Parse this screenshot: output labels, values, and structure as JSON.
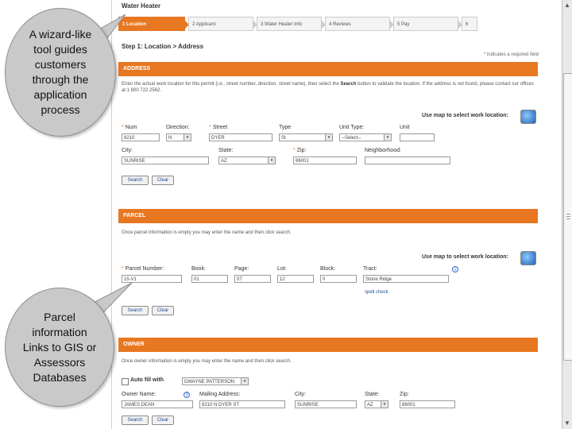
{
  "header": {
    "app_title": "Water Heater",
    "steps": [
      {
        "label": "1  Location",
        "active": true
      },
      {
        "label": "2  Applicant",
        "active": false
      },
      {
        "label": "3  Water Heater Info",
        "active": false
      },
      {
        "label": "4  Reviews",
        "active": false
      },
      {
        "label": "5  Pay",
        "active": false
      },
      {
        "label": "6",
        "active": false
      }
    ]
  },
  "step_heading": "Step 1: Location > Address",
  "required_note": "* indicates a required field",
  "address": {
    "title": "ADDRESS",
    "instruction_pre": "Enter the actual work location for this permit (i.e., street number, direction, street name), then select the",
    "instruction_search": "Search",
    "instruction_post": "button to validate the location.  If the address is not found, please contact our offices at 1 800 722 2562.",
    "map_link": "Use map to select work location:",
    "labels": {
      "num": "Num",
      "direction": "Direction:",
      "street": "Street",
      "type": "Type",
      "unit_type": "Unit Type:",
      "unit": "Unit",
      "city": "City:",
      "state": "State:",
      "zip": "Zip:",
      "neighborhood": "Neighborhood:"
    },
    "values": {
      "num": "8210",
      "direction": "N",
      "street": "DYER",
      "type": "St",
      "unit_type": "--Select--",
      "unit": "",
      "city": "SUNRISE",
      "state": "AZ",
      "zip": "86001",
      "neighborhood": ""
    },
    "search_btn": "Search",
    "clear_btn": "Clear"
  },
  "parcel": {
    "title": "PARCEL",
    "instruction": "Once parcel information is empty you may enter the name and then click search.",
    "map_link": "Use map to select work location:",
    "labels": {
      "parcel_number": "Parcel Number:",
      "book": "Book:",
      "page": "Page:",
      "lot": "Lot:",
      "block": "Block:",
      "tract": "Tract:"
    },
    "values": {
      "parcel_number": "15-V1",
      "book": "01",
      "page": "07",
      "lot": "12",
      "block": "0",
      "tract": "Stone Ridge"
    },
    "spell_check": "spell check",
    "search_btn": "Search",
    "clear_btn": "Clear"
  },
  "owner": {
    "title": "OWNER",
    "instruction": "Once owner information is empty you may enter the name and then click search.",
    "autofill_label": "Auto fill with",
    "autofill_value": "DWAYNE PATTERSON",
    "labels": {
      "owner_name": "Owner Name:",
      "mailing_address": "Mailing Address:",
      "city": "City:",
      "state": "State:",
      "zip": "Zip:"
    },
    "values": {
      "owner_name": "JAMES DEAN",
      "mailing_address": "8210 N DYER ST",
      "city": "SUNRISE",
      "state": "AZ",
      "zip": "86001"
    },
    "search_btn": "Search",
    "clear_btn": "Clear"
  },
  "callouts": {
    "wizard": "A wizard-like tool guides customers through the application process",
    "parcel_info": "Parcel information Links to GIS or Assessors Databases"
  },
  "colors": {
    "accent": "#e87722",
    "callout": "#c9c9c9"
  }
}
